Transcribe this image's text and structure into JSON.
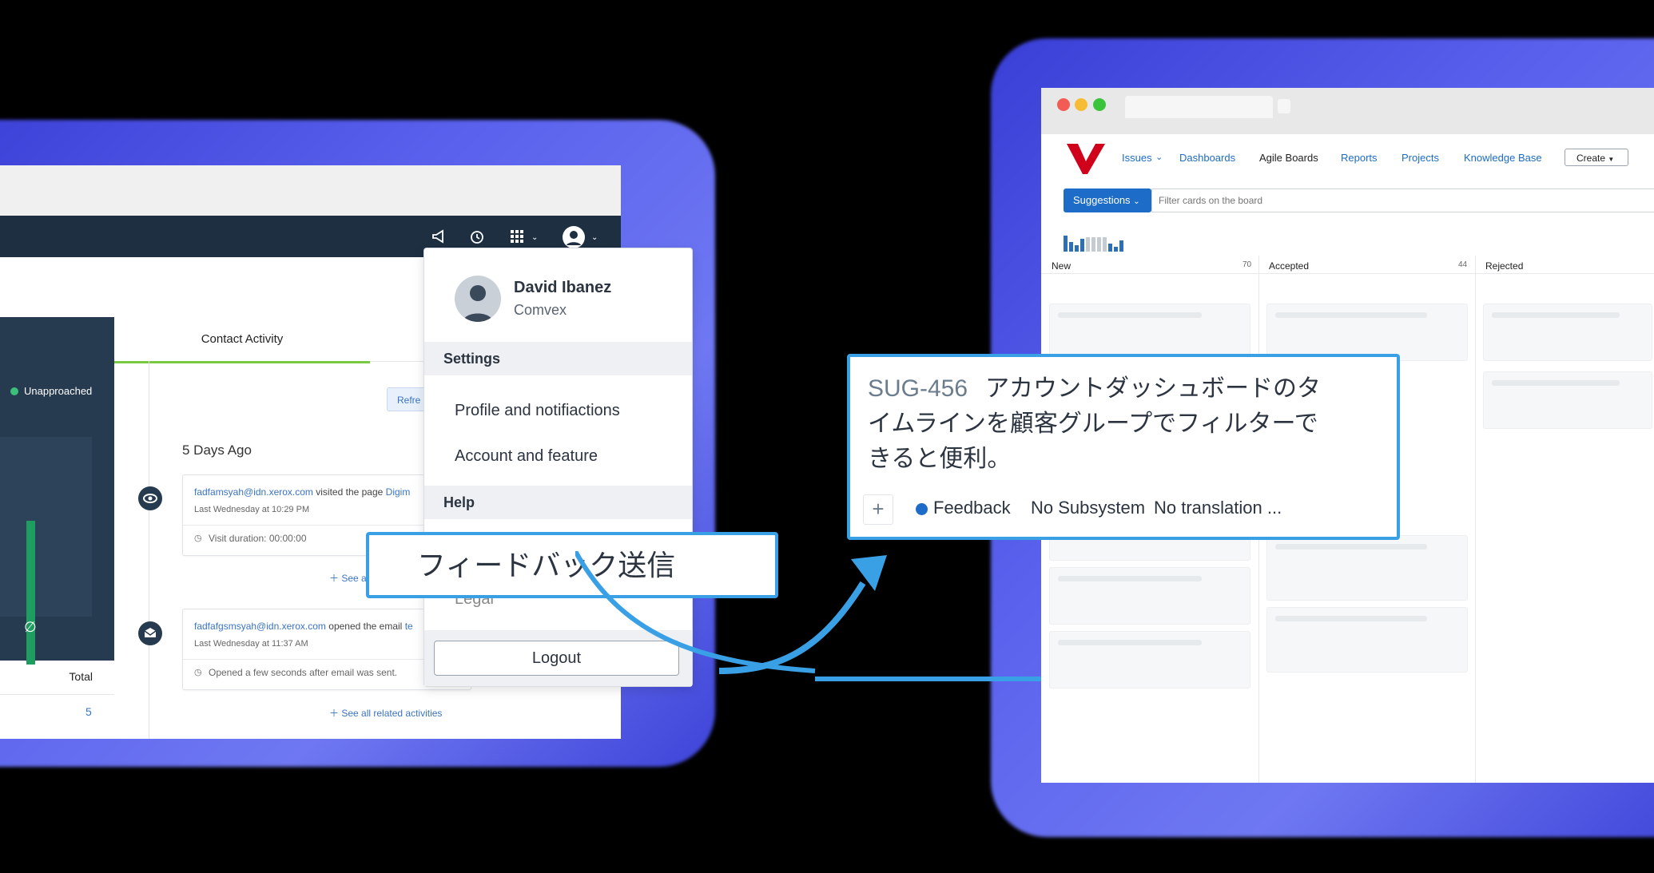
{
  "left_app": {
    "sidebar": {
      "status_label": "Unapproached"
    },
    "tabs": {
      "active": "Contact Activity"
    },
    "refresh_label": "Refre",
    "timeline": {
      "group_label": "5 Days Ago",
      "items": [
        {
          "email": "fadfamsyah@idn.xerox.com",
          "action": "visited the page",
          "target": "Digim",
          "time": "Last Wednesday at 10:29 PM",
          "detail": "Visit duration: 00:00:00"
        },
        {
          "email": "fadfafgsmsyah@idn.xerox.com",
          "action": "opened the email",
          "target": "te",
          "time": "Last Wednesday at 11:37 AM",
          "detail": "Opened a few seconds after email was sent."
        }
      ],
      "see_more_partial": "See a",
      "see_all_label": "See all related activities"
    },
    "table": {
      "total_label": "Total",
      "value": "5"
    },
    "dropdown": {
      "name": "David Ibanez",
      "company": "Comvex",
      "settings_label": "Settings",
      "settings_items": [
        "Profile and notifiactions",
        "Account and feature"
      ],
      "help_label": "Help",
      "legal_partial": "Legal",
      "logout_label": "Logout"
    }
  },
  "callout_left": {
    "text": "フィードバック送信"
  },
  "right_app": {
    "nav": {
      "items": [
        "Issues",
        "Dashboards",
        "Agile Boards",
        "Reports",
        "Projects",
        "Knowledge Base"
      ],
      "create_label": "Create"
    },
    "board_selector": "Suggestions",
    "filter_placeholder": "Filter cards on the board",
    "columns": [
      {
        "name": "New",
        "count": "70"
      },
      {
        "name": "Accepted",
        "count": "44"
      },
      {
        "name": "Rejected",
        "count": ""
      }
    ],
    "colors": {
      "brand": "#d0021b",
      "accent": "#1d6cc8"
    }
  },
  "callout_right": {
    "id": "SUG-456",
    "summary": "アカウントダッシュボードのタイムラインを顧客グループでフィルターできると便利。",
    "line1": "アカウントダッシュボードのタ",
    "line2": "イムラインを顧客グループでフィルターで",
    "line3": "きると便利。",
    "tag": "Feedback",
    "subsystem": "No Subsystem",
    "translation": "No translation ..."
  }
}
